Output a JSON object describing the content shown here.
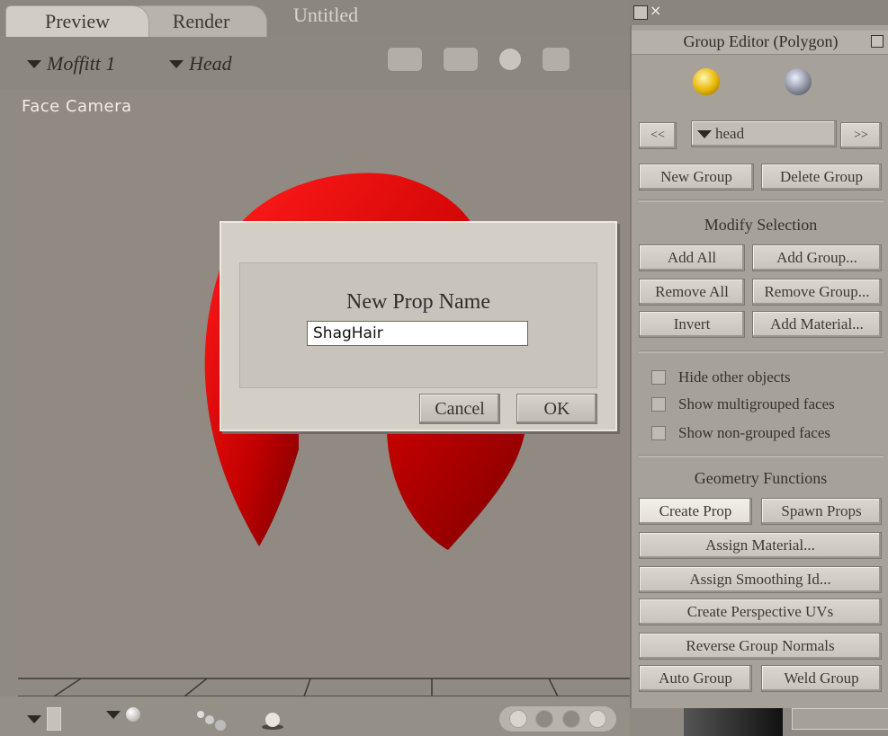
{
  "tabs": {
    "preview": "Preview",
    "render": "Render",
    "document_title": "Untitled"
  },
  "selectors": {
    "figure": "Moffitt 1",
    "actor": "Head"
  },
  "viewport": {
    "camera_label": "Face Camera"
  },
  "group_editor": {
    "title": "Group Editor  (Polygon)",
    "prev_label": "<<",
    "next_label": ">>",
    "group_selected": "head",
    "new_group": "New Group",
    "delete_group": "Delete Group",
    "modify_selection_heading": "Modify Selection",
    "add_all": "Add All",
    "add_group": "Add Group...",
    "remove_all": "Remove All",
    "remove_group": "Remove Group...",
    "invert": "Invert",
    "add_material": "Add Material...",
    "hide_other_objects": "Hide other objects",
    "show_multigrouped": "Show multigrouped faces",
    "show_nongrouped": "Show non-grouped faces",
    "geometry_heading": "Geometry Functions",
    "create_prop": "Create Prop",
    "spawn_props": "Spawn Props",
    "assign_material": "Assign Material...",
    "assign_smoothing": "Assign Smoothing Id...",
    "create_perspective_uvs": "Create Perspective UVs",
    "reverse_group_normals": "Reverse Group Normals",
    "auto_group": "Auto Group",
    "weld_group": "Weld Group"
  },
  "dialog": {
    "title": "New Prop Name",
    "input_value": "ShagHair",
    "cancel": "Cancel",
    "ok": "OK"
  },
  "colors": {
    "hair": "#d80000",
    "panel": "#a7a299",
    "viewport": "#908a82"
  }
}
